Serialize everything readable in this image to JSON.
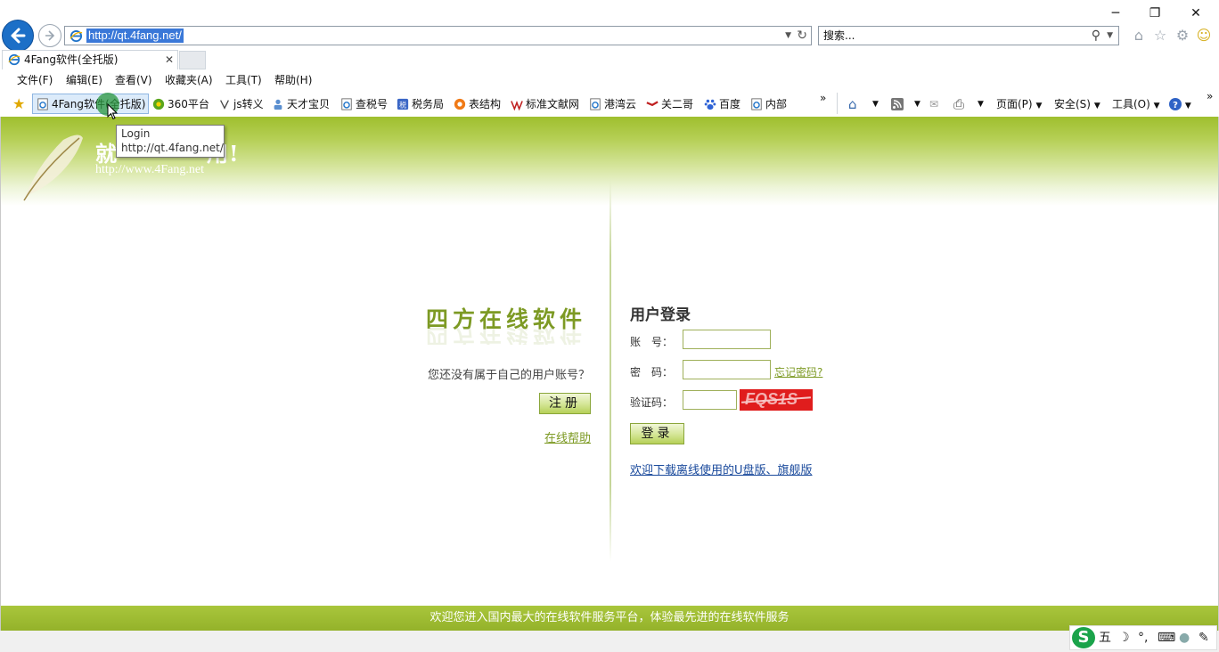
{
  "window": {
    "minimize_glyph": "─",
    "restore_glyph": "❐",
    "close_glyph": "✕"
  },
  "address": {
    "url": "http://qt.4fang.net/"
  },
  "search": {
    "placeholder": "搜索..."
  },
  "tab": {
    "title": "4Fang软件(全托版)"
  },
  "menu": {
    "items": [
      "文件(F)",
      "编辑(E)",
      "查看(V)",
      "收藏夹(A)",
      "工具(T)",
      "帮助(H)"
    ]
  },
  "favorites": {
    "items": [
      "4Fang软件(全托版)",
      "360平台",
      "js转义",
      "天才宝贝",
      "查税号",
      "税务局",
      "表结构",
      "标准文献网",
      "港湾云",
      "关二哥",
      "百度",
      "内部"
    ],
    "more": "»"
  },
  "commandbar": {
    "page": "页面(P)",
    "safety": "安全(S)",
    "tools": "工具(O)",
    "more": "»"
  },
  "tooltip": {
    "title": "Login",
    "url": "http://qt.4fang.net/"
  },
  "banner": {
    "title": "就　　　　用!",
    "url": "http://www.4Fang.net"
  },
  "left_panel": {
    "brand": "四方在线软件",
    "no_account": "您还没有属于自己的用户账号？",
    "register": "注册",
    "help": "在线帮助"
  },
  "login": {
    "title": "用户登录",
    "account_label": "账　号：",
    "password_label": "密　码：",
    "captcha_label": "验证码：",
    "forgot": "忘记密码?",
    "captcha_text": "FQS1S",
    "submit": "登录",
    "download": "欢迎下载离线使用的U盘版、旗舰版"
  },
  "footer": {
    "text": "欢迎您进入国内最大的在线软件服务平台，体验最先进的在线软件服务"
  },
  "ime": {
    "logo": "S",
    "mode": "五",
    "moon": "☽",
    "punct": "°,",
    "keyboard": "⌨",
    "user": "👤",
    "settings": "🔧"
  },
  "colors": {
    "accent_green": "#9fbf2e",
    "link_blue": "#1a4a9c",
    "captcha_red": "#e01d1d"
  }
}
